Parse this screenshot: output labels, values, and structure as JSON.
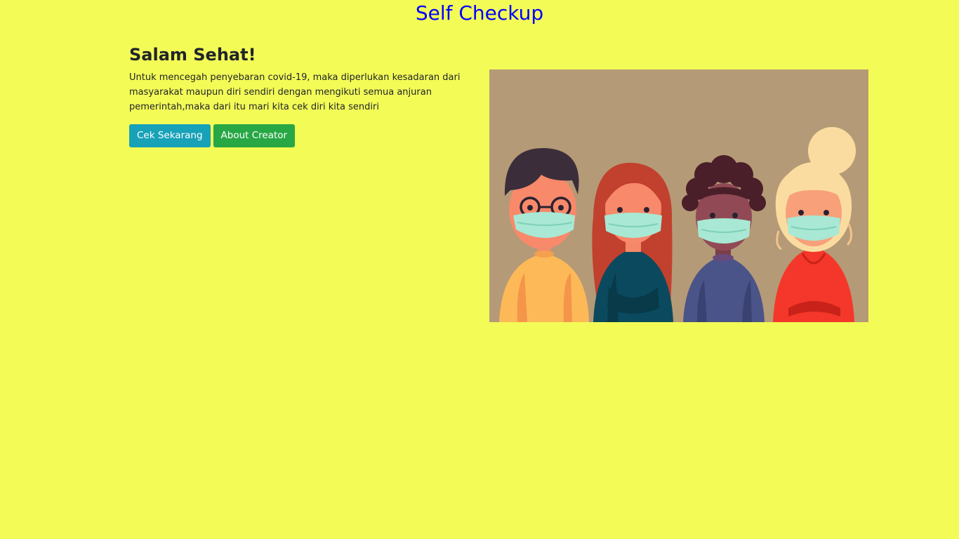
{
  "header": {
    "title": "Self Checkup"
  },
  "hero": {
    "heading": "Salam Sehat!",
    "description": "Untuk mencegah penyebaran covid-19, maka diperlukan kesadaran dari masyarakat maupun diri sendiri dengan mengikuti semua anjuran pemerintah,maka dari itu mari kita cek diri kita sendiri",
    "buttons": {
      "check": "Cek Sekarang",
      "about": "About Creator"
    }
  },
  "colors": {
    "background": "#f3fb57",
    "title": "#0000ff",
    "info_button": "#17a2b8",
    "success_button": "#28a745"
  },
  "illustration": {
    "icon": "people-wearing-masks-illustration"
  }
}
